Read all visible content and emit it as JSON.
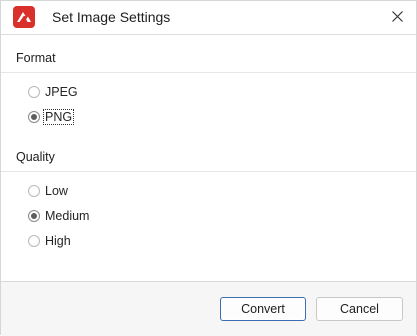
{
  "dialog": {
    "title": "Set Image Settings",
    "app_icon": "app-logo-icon",
    "close_icon": "close-icon"
  },
  "format": {
    "label": "Format",
    "options": [
      {
        "label": "JPEG",
        "selected": false
      },
      {
        "label": "PNG",
        "selected": true
      }
    ]
  },
  "quality": {
    "label": "Quality",
    "options": [
      {
        "label": "Low",
        "selected": false
      },
      {
        "label": "Medium",
        "selected": true
      },
      {
        "label": "High",
        "selected": false
      }
    ]
  },
  "buttons": {
    "convert": "Convert",
    "cancel": "Cancel"
  },
  "colors": {
    "app_icon_red": "#d9302b",
    "primary_button_border": "#3c6eb4"
  }
}
